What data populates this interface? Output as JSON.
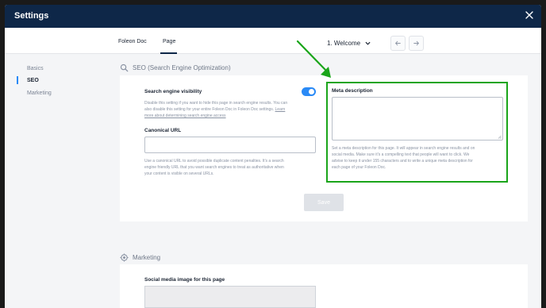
{
  "window": {
    "title": "Settings"
  },
  "topnav": {
    "tabs": [
      "Foleon Doc",
      "Page"
    ],
    "active_tab": "Page",
    "page_selector": "1. Welcome"
  },
  "sidebar": {
    "items": [
      "Basics",
      "SEO",
      "Marketing"
    ],
    "active": "SEO"
  },
  "seo": {
    "heading": "SEO (Search Engine Optimization)",
    "visibility": {
      "label": "Search engine visibility",
      "help_lines": [
        "Disable this setting if you want to hide this page in search engine results. You can",
        "also disable this setting for your entire Foleon Doc in Foleon Doc settings.",
        "more about determining search engine access"
      ],
      "help_link_word": "Learn",
      "enabled": true
    },
    "canonical": {
      "label": "Canonical URL",
      "value": "",
      "help_lines": [
        "Use a canonical URL to avoid possible duplicate content penalties. It's a search",
        "engine friendly URL that you want search engines to treat as authoritative when",
        "your content is visible on several URLs."
      ]
    },
    "meta": {
      "label": "Meta description",
      "value": "",
      "help_lines": [
        "Set a meta description for this page. It will appear in search engine results and on",
        "social media. Make sure it's a compelling text that people will want to click. We",
        "advise to keep it under 155 characters and to write a unique meta description for",
        "each page of your Foleon Doc."
      ]
    },
    "save_label": "Save"
  },
  "marketing": {
    "heading": "Marketing",
    "social_image_label": "Social media image for this page"
  },
  "colors": {
    "titlebar": "#0e2748",
    "accent": "#2a8af6",
    "highlight": "#1aa51a"
  }
}
